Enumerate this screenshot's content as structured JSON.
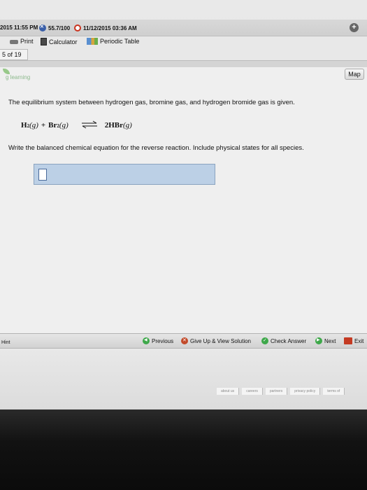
{
  "status_bar": {
    "start_time": "2015 11:55 PM",
    "score": "55.7/100",
    "due_time": "11/12/2015 03:36 AM"
  },
  "toolbar": {
    "print_label": "Print",
    "calculator_label": "Calculator",
    "periodic_table_label": "Periodic Table"
  },
  "question_counter": "5 of 19",
  "map_label": "Map",
  "learning_label": "g learning",
  "question": {
    "text": "The equilibrium system between hydrogen gas, bromine gas, and hydrogen bromide gas is given.",
    "equation": {
      "h2": "H",
      "h2_sub": "2",
      "h2_state": "(g)",
      "plus": "+",
      "br2": "Br",
      "br2_sub": "2",
      "br2_state": "(g)",
      "product": "2HBr",
      "product_state": "(g)"
    },
    "instruction": "Write the balanced chemical equation for the reverse reaction. Include physical states for all species."
  },
  "bottom_bar": {
    "hint_label": "Hint",
    "previous_label": "Previous",
    "give_up_label": "Give Up & View Solution",
    "check_label": "Check Answer",
    "next_label": "Next",
    "exit_label": "Exit"
  },
  "footer_links": [
    "about us",
    "careers",
    "partners",
    "privacy policy",
    "terms of"
  ]
}
